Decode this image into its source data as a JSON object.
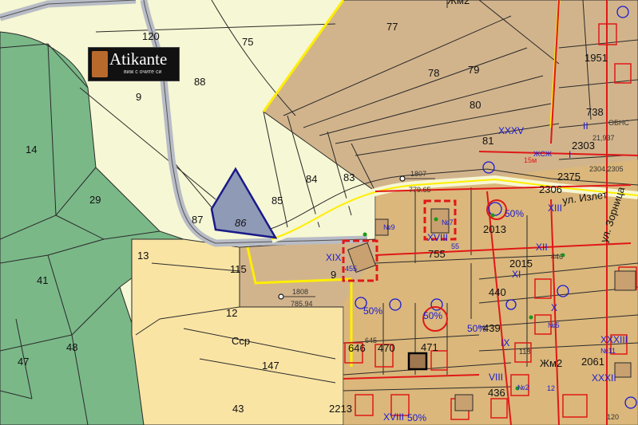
{
  "logo": {
    "title": "Atikante",
    "tagline": "виж с очите си"
  },
  "highlighted_parcel": "86",
  "colors": {
    "forest": "#7ab888",
    "forest_dark": "#6aa879",
    "pale_green": "#f6f7d4",
    "tan": "#d2b48c",
    "cream": "#fae4a4",
    "road": "#b8bcc6",
    "parcel_highlight": "#8f9ab6",
    "red": "#e01818",
    "blue": "#1a1ad0",
    "yellow": "#ffee00"
  },
  "parcels": {
    "p120": "120",
    "p75": "75",
    "p88": "88",
    "p9a": "9",
    "p14": "14",
    "p29": "29",
    "p13": "13",
    "p41": "41",
    "p48": "48",
    "p47": "47",
    "p87": "87",
    "p86": "86",
    "p85": "85",
    "p84": "84",
    "p83": "83",
    "p77": "77",
    "p78": "78",
    "p79": "79",
    "p80": "80",
    "p81": "81",
    "p115": "115",
    "p9b": "9",
    "p12": "12",
    "p147": "147",
    "p43": "43",
    "p755": "755",
    "p2013": "2013",
    "p2015": "2015",
    "p440": "440",
    "p439": "439",
    "p436": "436",
    "p2213": "2213",
    "p646": "646",
    "p470": "470",
    "p471": "471",
    "p738": "738",
    "p1951": "1951",
    "p2303": "2303",
    "p2375": "2375",
    "p2306": "2306",
    "p2061": "2061",
    "p446": "446"
  },
  "zones": {
    "jm2_top": "Жм2",
    "ssr": "Сср",
    "jm2_mid": "Жм2"
  },
  "streets": {
    "izlet": "ул. Излет",
    "zornitsa": "ул. Зорница"
  },
  "benchmarks": [
    {
      "id": "1807",
      "elev": "779.65"
    },
    {
      "id": "1808",
      "elev": "785.94"
    }
  ],
  "roman": {
    "r1": "XIX",
    "r2": "XVIII",
    "r3": "XXXV",
    "r4": "XII",
    "r5": "XI",
    "r6": "IX",
    "r7": "VIII",
    "r8": "XXXIII",
    "r9": "XVIII",
    "r10": "II",
    "r11": "I",
    "r12": "XIII",
    "r13": "X",
    "r14": "XXXII"
  },
  "misc": {
    "obns": "ОБНС",
    "area": "21,937",
    "pair": "2304,2305",
    "n7": "№7",
    "n9": "№9",
    "n5": "№5",
    "n11": "№11",
    "n2": "№2",
    "pct1": "50%",
    "pct2": "50%",
    "pct3": "50%",
    "pct4": "50%",
    "pct5": "50%",
    "jzh": "ЖСЖ",
    "m15": "15м",
    "g118": "118",
    "g120": "120",
    "g645": "645",
    "g455": "455",
    "g55": "55",
    "g12": "12"
  }
}
